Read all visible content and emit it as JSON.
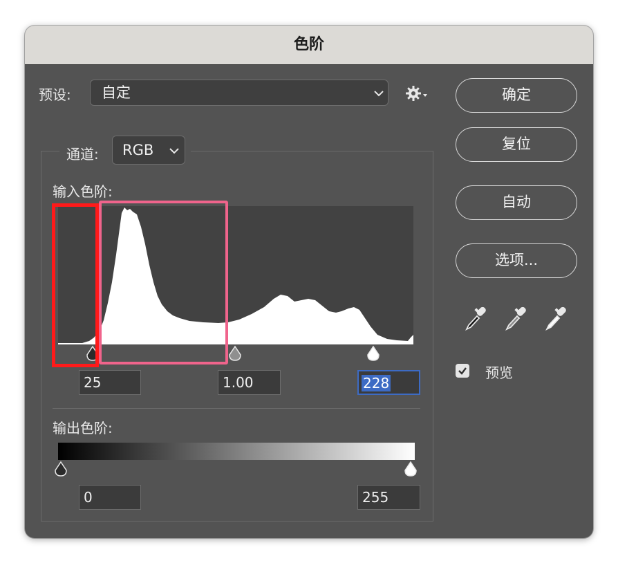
{
  "dialog": {
    "title": "色阶"
  },
  "preset": {
    "label": "预设:",
    "value": "自定"
  },
  "buttons": {
    "ok": "确定",
    "reset": "复位",
    "auto": "自动",
    "options": "选项..."
  },
  "channel": {
    "label": "通道:",
    "value": "RGB"
  },
  "input_levels": {
    "label": "输入色阶:",
    "black": "25",
    "gamma": "1.00",
    "white": "228"
  },
  "output_levels": {
    "label": "输出色阶:",
    "black": "0",
    "white": "255"
  },
  "preview": {
    "label": "预览",
    "checked": true
  },
  "colors": {
    "dialog_bg": "#535353",
    "titlebar": "#dcdad6",
    "focus": "#3d6bc4",
    "highlight_red": "#ff1a1a",
    "highlight_pink": "#f0648c"
  },
  "icons": [
    "chevron-down-icon",
    "gear-icon",
    "black-eyedropper-icon",
    "gray-eyedropper-icon",
    "white-eyedropper-icon",
    "checkmark-icon"
  ]
}
